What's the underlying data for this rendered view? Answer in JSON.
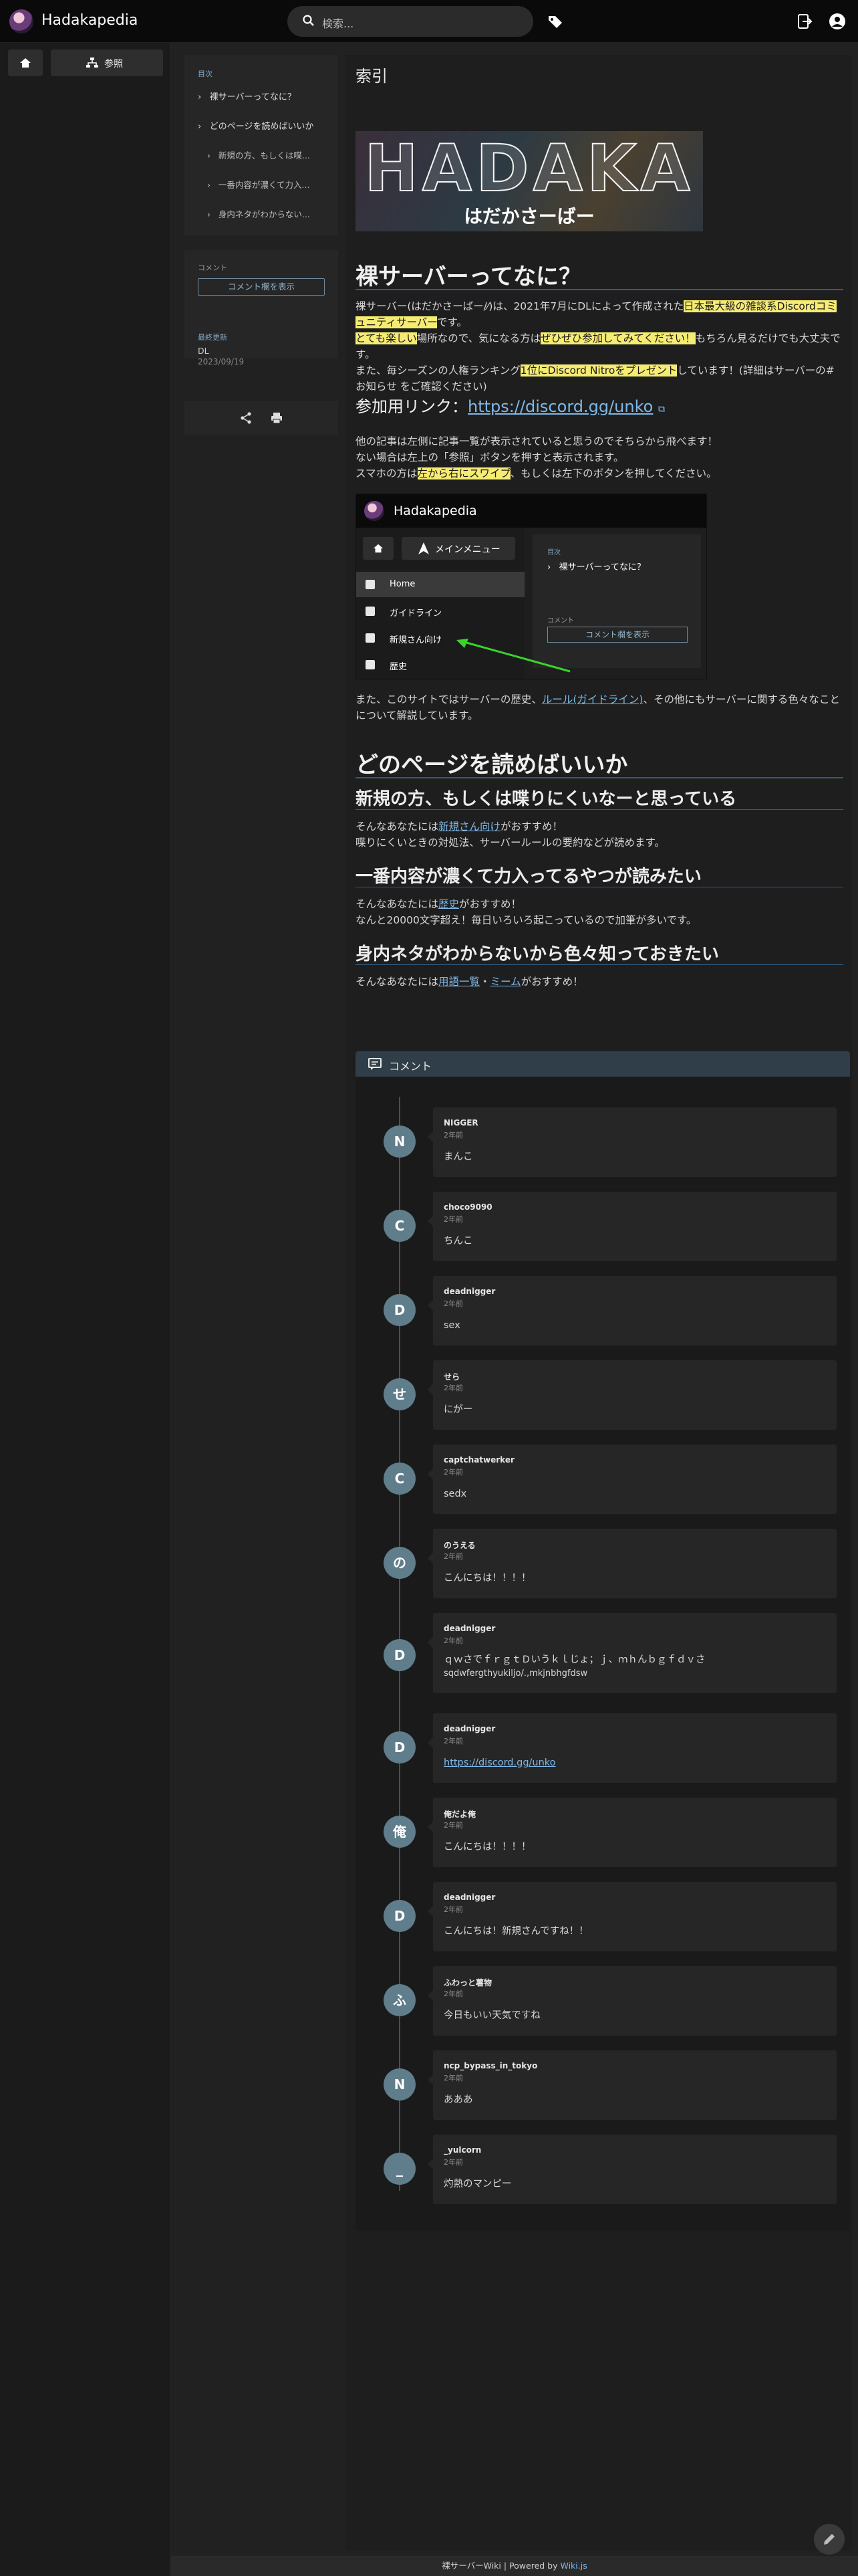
{
  "header": {
    "site_title": "Hadakapedia",
    "search_placeholder": "検索...",
    "icons": [
      "logo-avatar",
      "search-icon",
      "tag-icon",
      "login-icon",
      "user-icon"
    ]
  },
  "sidebar": {
    "home_icon": "home-icon",
    "reference_label": "参照"
  },
  "toc": {
    "heading": "目次",
    "items": [
      {
        "label": "裸サーバーってなに？"
      },
      {
        "label": "どのページを読めばいいか"
      },
      {
        "label": "新規の方、もしくは喋..."
      },
      {
        "label": "一番内容が濃くて力入..."
      },
      {
        "label": "身内ネタがわからない..."
      }
    ]
  },
  "meta_panel": {
    "comments_label": "コメント",
    "show_comments_button": "コメント欄を表示",
    "updated_label": "最終更新",
    "updated_by": "DL",
    "updated_date": "2023/09/19"
  },
  "page": {
    "title": "索引",
    "banner_title": "HADAKA",
    "banner_subtitle": "はだかさーばー",
    "section1": {
      "heading": "裸サーバーってなに？",
      "p1_a": "裸サーバー(はだかさーばー/⁄)は、2021年7月にDLによって作成された",
      "p1_hl1": "日本最大級の雑談系Discordコミュニティサーバー",
      "p1_b": "です。",
      "p1_hl2": "とても楽しい",
      "p1_c": "場所なので、気になる方は",
      "p1_hl3": "ぜひぜひ参加してみてください！",
      "p1_d": "もちろん見るだけでも大丈夫です。",
      "p2_a": "また、毎シーズンの人権ランキング",
      "p2_hl": "1位にDiscord Nitroをプレゼント",
      "p2_b": "しています！(詳細はサーバーの#お知らせ をご確認ください)",
      "join_label": "参加用リンク：",
      "join_url": "https://discord.gg/unko",
      "p3_1": "他の記事は左側に記事一覧が表示されていると思うのでそちらから飛べます！",
      "p3_2": "ない場合は左上の「参照」ボタンを押すと表示されます。",
      "p3_3a": "スマホの方は",
      "p3_3hl": "左から右にスワイプ",
      "p3_3b": "、もしくは左下のボタンを押してください。",
      "p4_a": "また、このサイトではサーバーの歴史、",
      "p4_link": "ルール(ガイドライン)",
      "p4_b": "、その他にもサーバーに関する色々なことについて解説しています。"
    },
    "screenshot": {
      "name": "Hadakapedia",
      "menu_button": "メインメニュー",
      "nav": [
        "Home",
        "ガイドライン",
        "新規さん向け",
        "歴史"
      ],
      "toc_head": "目次",
      "toc_item": "裸サーバーってなに？",
      "comment_label": "コメント",
      "comment_button": "コメント欄を表示"
    },
    "section2": {
      "heading": "どのページを読めばいいか",
      "sub1_heading": "新規の方、もしくは喋りにくいなーと思っている",
      "sub1_p1a": "そんなあなたには",
      "sub1_link": "新規さん向け",
      "sub1_p1b": "がおすすめ！",
      "sub1_p2": "喋りにくいときの対処法、サーバールールの要約などが読めます。",
      "sub2_heading": "一番内容が濃くて力入ってるやつが読みたい",
      "sub2_p1a": "そんなあなたには",
      "sub2_link": "歴史",
      "sub2_p1b": "がおすすめ！",
      "sub2_p2": "なんと20000文字超え！毎日いろいろ起こっているので加筆が多いです。",
      "sub3_heading": "身内ネタがわからないから色々知っておきたい",
      "sub3_p1a": "そんなあなたには",
      "sub3_link1": "用語一覧",
      "sub3_sep": "・",
      "sub3_link2": "ミーム",
      "sub3_p1b": "がおすすめ！"
    }
  },
  "comments": {
    "heading": "コメント",
    "items": [
      {
        "avatar": "N",
        "user": "NIGGER",
        "time": "2年前",
        "text": "まんこ"
      },
      {
        "avatar": "C",
        "user": "choco9090",
        "time": "2年前",
        "text": "ちんこ"
      },
      {
        "avatar": "D",
        "user": "deadnigger",
        "time": "2年前",
        "text": "sex"
      },
      {
        "avatar": "せ",
        "user": "せら",
        "time": "2年前",
        "text": "にがー"
      },
      {
        "avatar": "C",
        "user": "captchatwerker",
        "time": "2年前",
        "text": "sedx"
      },
      {
        "avatar": "の",
        "user": "のうえる",
        "time": "2年前",
        "text": "こんにちは！！！！"
      },
      {
        "avatar": "D",
        "user": "deadnigger",
        "time": "2年前",
        "text": "ｑｗさでｆｒｇｔＤいうｋｌじょ；ｊ、ｍｈんｂｇｆｄｖさ",
        "text2": "sqdwfergthyukiljo/.,mkjnbhgfdsw"
      },
      {
        "avatar": "D",
        "user": "deadnigger",
        "time": "2年前",
        "link": "https://discord.gg/unko"
      },
      {
        "avatar": "俺",
        "user": "俺だよ俺",
        "time": "2年前",
        "text": "こんにちは！！！！"
      },
      {
        "avatar": "D",
        "user": "deadnigger",
        "time": "2年前",
        "text": "こんにちは！新規さんですね！！"
      },
      {
        "avatar": "ふ",
        "user": "ふわっと薯物",
        "time": "2年前",
        "text": "今日もいい天気ですね"
      },
      {
        "avatar": "N",
        "user": "ncp_bypass_in_tokyo",
        "time": "2年前",
        "text": "あああ"
      },
      {
        "avatar": "_",
        "user": "_yulcorn",
        "time": "2年前",
        "text": "灼熱のマンピー"
      }
    ]
  },
  "footer": {
    "text": "裸サーバーWiki | Powered by",
    "link": "Wiki.js"
  },
  "fab_icon": "pencil-icon"
}
